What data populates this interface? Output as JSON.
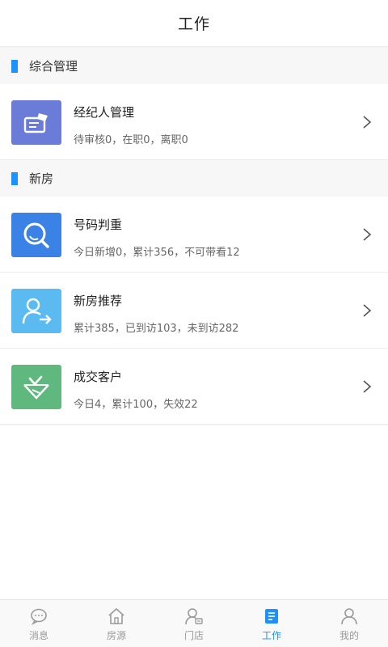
{
  "header": {
    "title": "工作"
  },
  "sections": [
    {
      "title": "综合管理",
      "items": [
        {
          "title": "经纪人管理",
          "subtitle": "待审核0，在职0，离职0",
          "icon": "agent-card-icon",
          "color": "#6b7bd8"
        }
      ]
    },
    {
      "title": "新房",
      "items": [
        {
          "title": "号码判重",
          "subtitle": "今日新增0，累计356，不可带看12",
          "icon": "search-magnifier-icon",
          "color": "#3b82e6"
        },
        {
          "title": "新房推荐",
          "subtitle": "累计385，已到访103，未到访282",
          "icon": "user-recommend-icon",
          "color": "#5bbbf0"
        },
        {
          "title": "成交客户",
          "subtitle": "今日4，累计100，失效22",
          "icon": "deal-handshake-icon",
          "color": "#5fb87e"
        }
      ]
    }
  ],
  "tabbar": {
    "tabs": [
      {
        "label": "消息",
        "icon": "message-icon",
        "active": false
      },
      {
        "label": "房源",
        "icon": "house-icon",
        "active": false
      },
      {
        "label": "门店",
        "icon": "store-icon",
        "active": false
      },
      {
        "label": "工作",
        "icon": "work-icon",
        "active": true
      },
      {
        "label": "我的",
        "icon": "profile-icon",
        "active": false
      }
    ],
    "active_color": "#1e90ff"
  }
}
